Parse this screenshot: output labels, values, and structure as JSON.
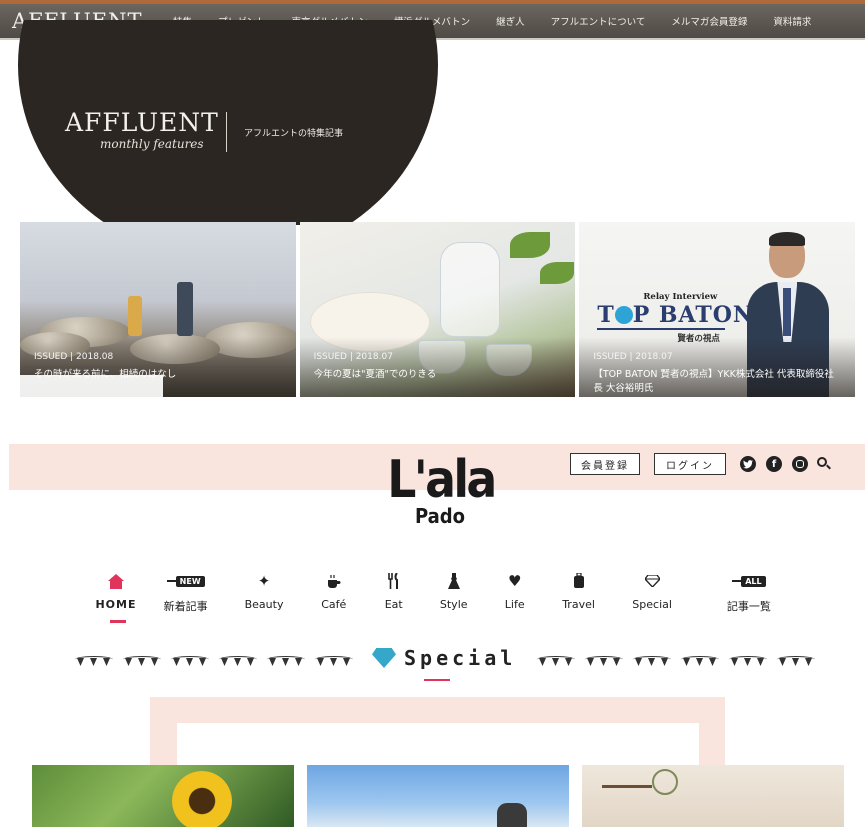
{
  "affluent": {
    "logo": "AFFLUENT",
    "menu": [
      "特集",
      "プレゼント",
      "東京グルメバトン",
      "横浜グルメバトン",
      "継ぎ人",
      "アフルエントについて",
      "メルマガ会員登録",
      "資料請求"
    ],
    "hero": {
      "title": "AFFLUENT",
      "subtitle": "monthly features",
      "label": "アフルエントの特集記事"
    },
    "cards": [
      {
        "meta": "ISSUED | 2018.08",
        "title": "その時が来る前に、相続のはなし"
      },
      {
        "meta": "ISSUED | 2018.07",
        "title": "今年の夏は\"夏酒\"でのりきる"
      },
      {
        "meta": "ISSUED | 2018.07",
        "title": "【TOP BATON 賢者の視点】YKK株式会社 代表取締役社長 大谷裕明氏",
        "image_text": {
          "small": "Relay Interview",
          "big_pre": "T",
          "big_post": "P BATON",
          "jp": "賢者の視点"
        }
      }
    ]
  },
  "lala": {
    "logo_main": "L'ala",
    "logo_sub": "Pado",
    "register_label": "会員登録",
    "login_label": "ログイン",
    "social": {
      "twitter": "twitter-icon",
      "facebook": "facebook-icon",
      "instagram": "instagram-icon",
      "search": "search-icon"
    },
    "accent_color": "#e0345a",
    "nav": [
      {
        "label": "HOME",
        "icon": "home-icon",
        "active": true
      },
      {
        "label": "新着記事",
        "icon": "new-tag-icon",
        "tag": "NEW"
      },
      {
        "label": "Beauty",
        "icon": "sparkle-icon"
      },
      {
        "label": "Café",
        "icon": "coffee-icon"
      },
      {
        "label": "Eat",
        "icon": "cutlery-icon"
      },
      {
        "label": "Style",
        "icon": "dress-icon"
      },
      {
        "label": "Life",
        "icon": "heart-icon"
      },
      {
        "label": "Travel",
        "icon": "suitcase-icon"
      },
      {
        "label": "Special",
        "icon": "diamond-icon"
      },
      {
        "label": "記事一覧",
        "icon": "all-tag-icon",
        "tag": "ALL"
      }
    ],
    "section_title": "Special"
  }
}
